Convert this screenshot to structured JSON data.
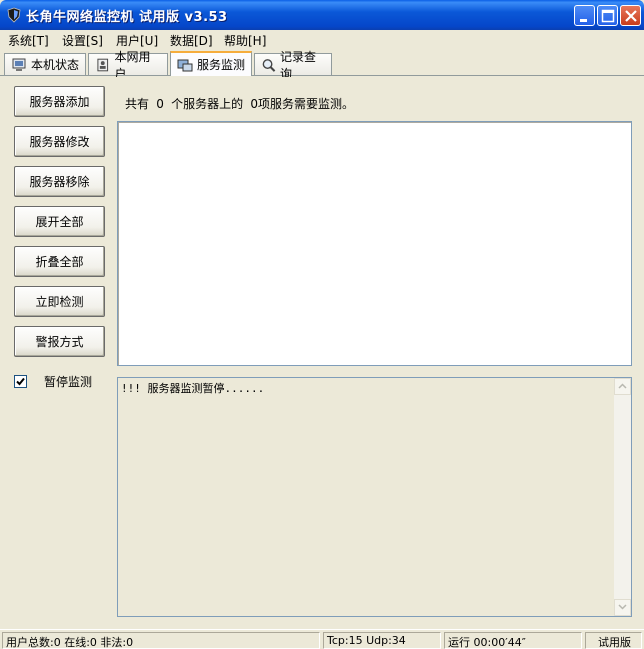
{
  "window": {
    "title": "长角牛网络监控机 试用版 v3.53"
  },
  "menu": {
    "items": [
      "系统[T]",
      "设置[S]",
      "用户[U]",
      "数据[D]",
      "帮助[H]"
    ]
  },
  "tabs": [
    {
      "label": "本机状态",
      "icon": "computer-status-icon"
    },
    {
      "label": "本网用户",
      "icon": "network-users-icon"
    },
    {
      "label": "服务监测",
      "icon": "service-monitor-icon",
      "active": true
    },
    {
      "label": "记录查询",
      "icon": "record-search-icon"
    }
  ],
  "sidebar": {
    "buttons": [
      "服务器添加",
      "服务器修改",
      "服务器移除",
      "展开全部",
      "折叠全部",
      "立即检测",
      "警报方式"
    ]
  },
  "summary": {
    "prefix": "共有",
    "server_count": "0",
    "mid": "个服务器上的",
    "service_count": "0",
    "suffix": "项服务需要监测。"
  },
  "pause": {
    "label": "暂停监测",
    "checked": true
  },
  "log": {
    "text": "!!! 服务器监测暂停......"
  },
  "status": {
    "users": "用户总数:0 在线:0 非法:0",
    "ports": "Tcp:15 Udp:34",
    "runtime": "运行 00:00′44″",
    "edition": "试用版"
  }
}
